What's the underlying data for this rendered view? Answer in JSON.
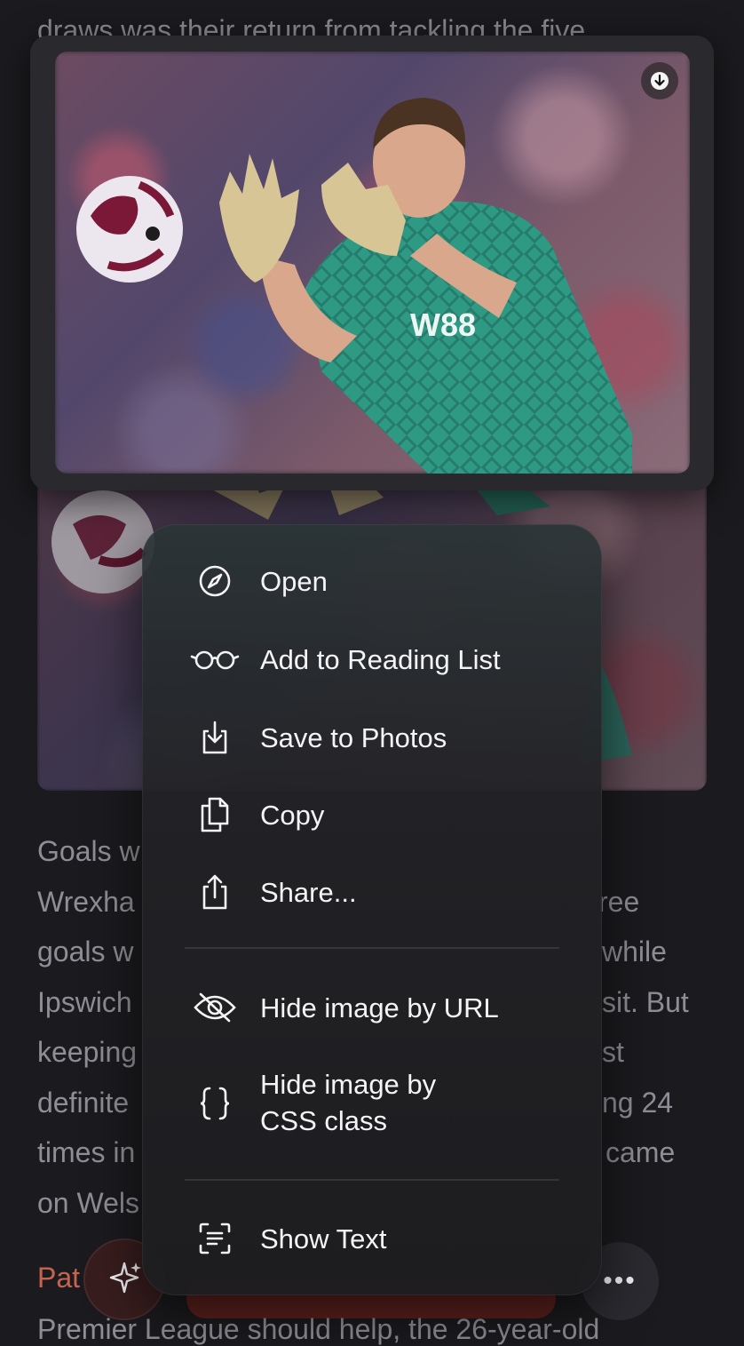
{
  "background": {
    "top_text": "draws was their return from tackling the five",
    "paragraph_lines": [
      {
        "left": "Goals w",
        "right": ""
      },
      {
        "left": "Wrexha",
        "right": "ree"
      },
      {
        "left": "goals w",
        "right": "while"
      },
      {
        "left": "Ipswich",
        "right": "sit. But"
      },
      {
        "left": "keeping",
        "right": "st"
      },
      {
        "left": "definite",
        "right": "ng 24"
      },
      {
        "left": "times in",
        "right": "came"
      },
      {
        "left": "on Wels",
        "right": ""
      }
    ],
    "heading_fragment": "Pat",
    "bottom_text": "Premier League should help, the 26-year-old"
  },
  "buttons": {
    "ai_icon": "sparkles-icon",
    "more_label": "•••"
  },
  "preview": {
    "download_icon": "download-icon",
    "shirt_sponsor": "W88"
  },
  "menu": {
    "items": [
      {
        "label": "Open",
        "icon": "compass-icon"
      },
      {
        "label": "Add to Reading List",
        "icon": "glasses-icon"
      },
      {
        "label": "Save to Photos",
        "icon": "save-download-icon"
      },
      {
        "label": "Copy",
        "icon": "copy-icon"
      },
      {
        "label": "Share...",
        "icon": "share-icon"
      },
      {
        "label": "Hide image by URL",
        "icon": "eye-slash-icon"
      },
      {
        "label_line1": "Hide image by",
        "label_line2": "CSS class",
        "icon": "curly-braces-icon"
      },
      {
        "label": "Show Text",
        "icon": "text-scan-icon"
      }
    ]
  },
  "colors": {
    "background": "#1b1b1f",
    "menu_text": "#f4f4f6",
    "heading_accent": "#c6644f"
  }
}
